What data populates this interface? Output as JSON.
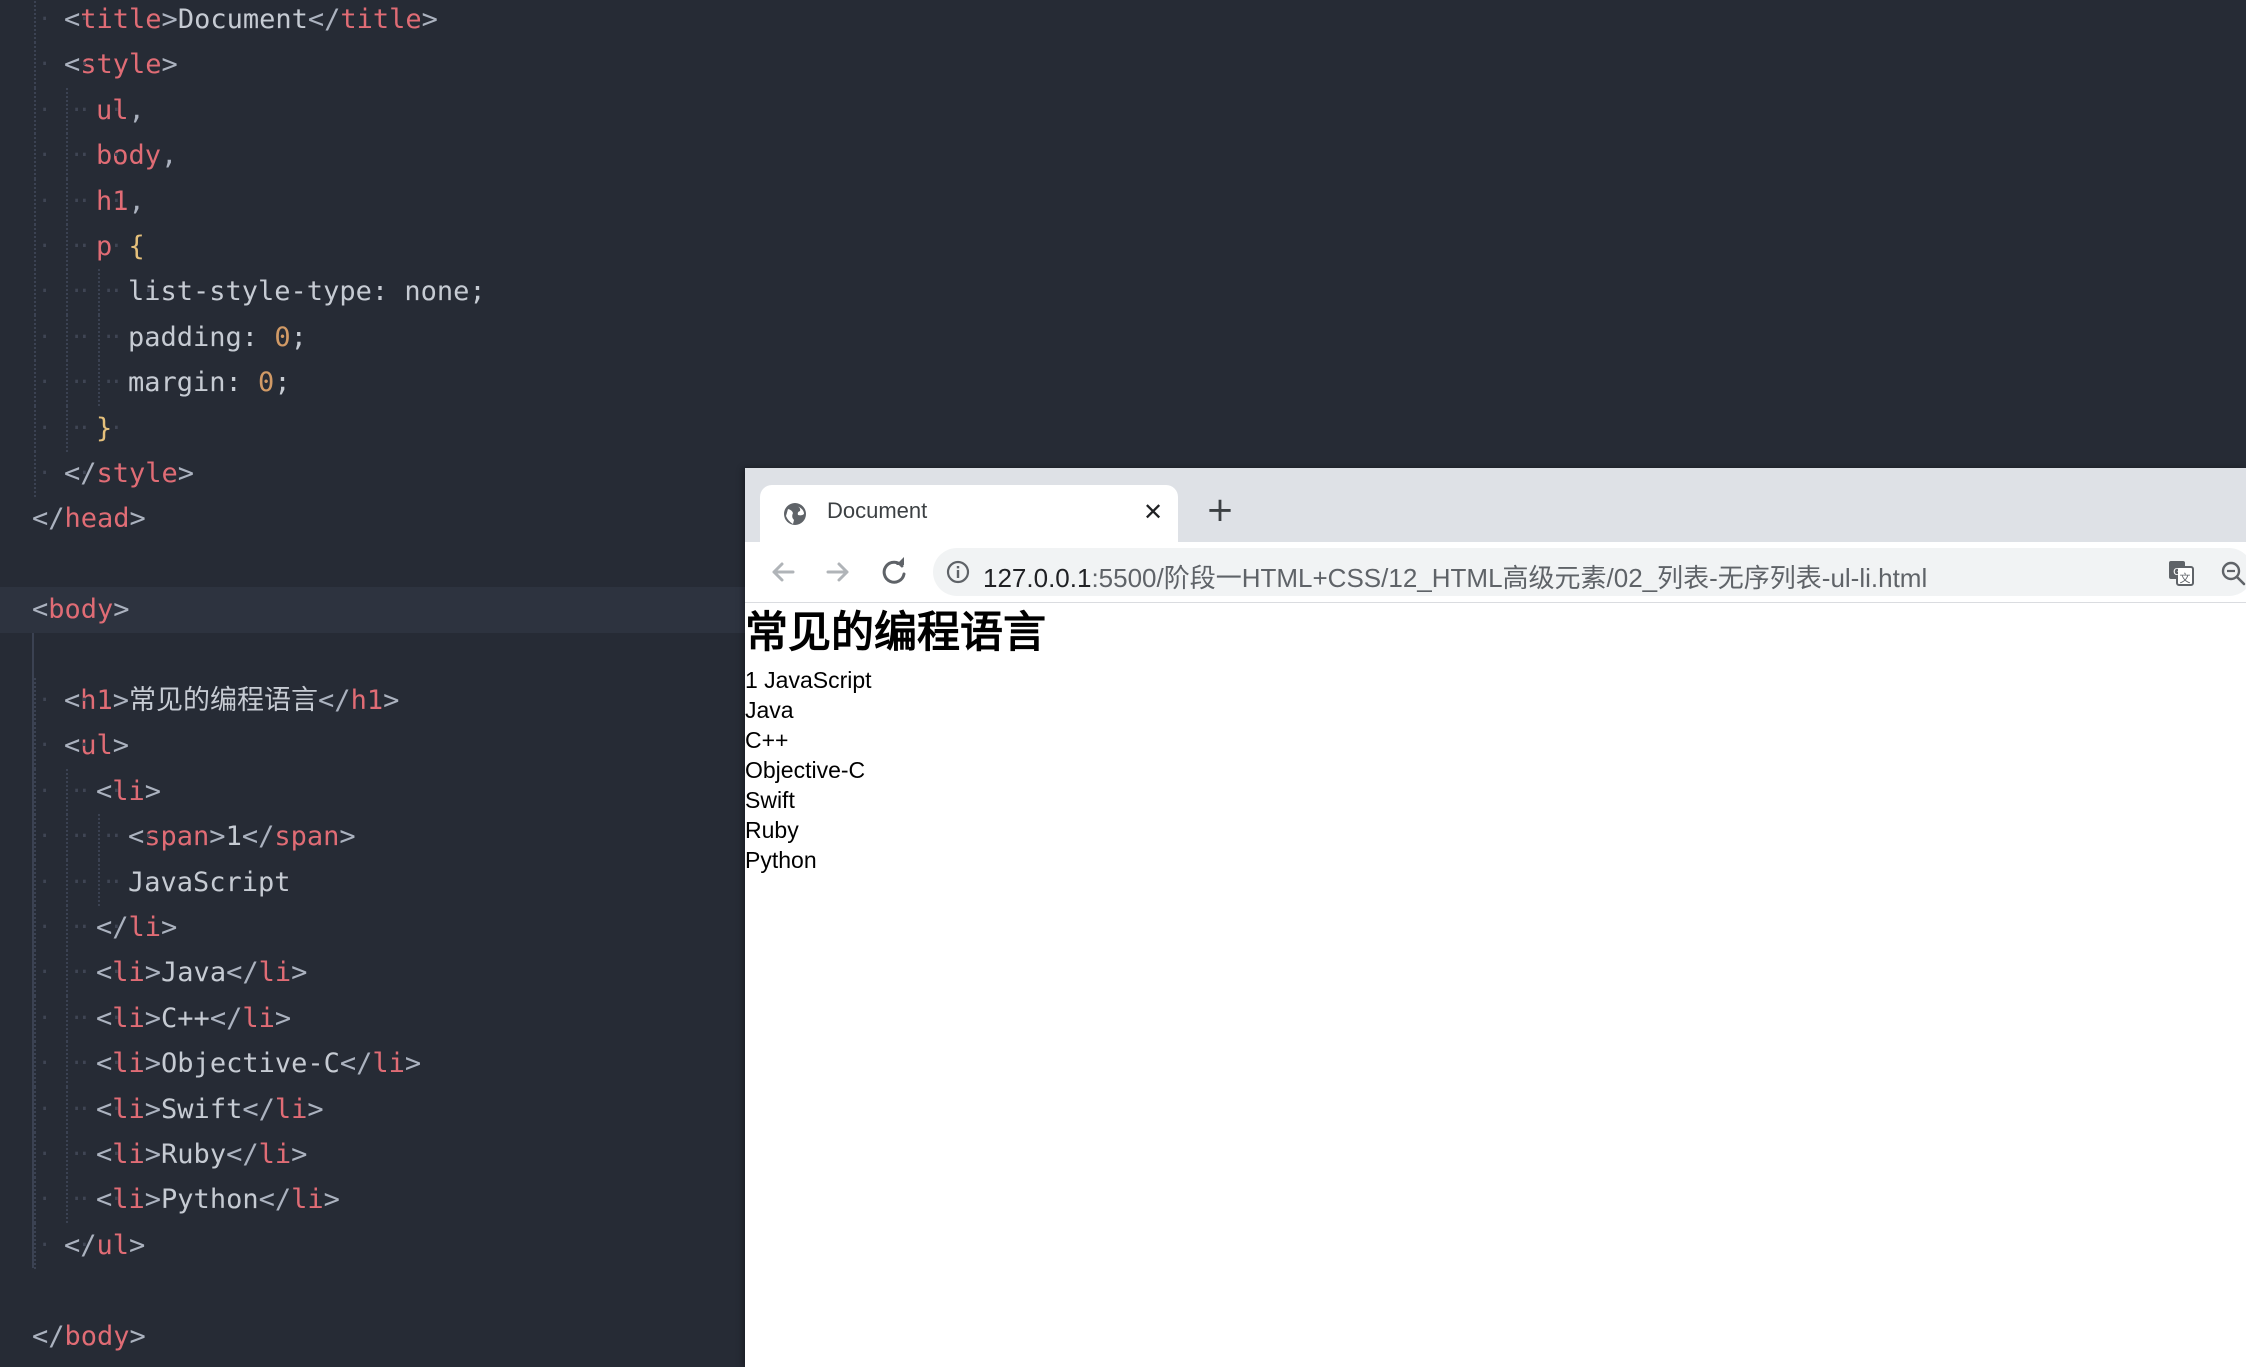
{
  "editor": {
    "lines": [
      [
        [
          "tk-br",
          "<"
        ],
        [
          "tk-tag",
          "title"
        ],
        [
          "tk-br",
          ">"
        ],
        [
          "tk-text",
          "Document"
        ],
        [
          "tk-br",
          "</"
        ],
        [
          "tk-tag",
          "title"
        ],
        [
          "tk-br",
          ">"
        ]
      ],
      [
        [
          "tk-br",
          "<"
        ],
        [
          "tk-tag",
          "style"
        ],
        [
          "tk-br",
          ">"
        ]
      ],
      [
        [
          "tk-sel",
          "ul"
        ],
        [
          "tk-punc",
          ","
        ]
      ],
      [
        [
          "tk-sel",
          "body"
        ],
        [
          "tk-punc",
          ","
        ]
      ],
      [
        [
          "tk-sel",
          "h1"
        ],
        [
          "tk-punc",
          ","
        ]
      ],
      [
        [
          "tk-sel",
          "p "
        ],
        [
          "tk-brace",
          "{"
        ]
      ],
      [
        [
          "tk-prop",
          "list-style-type: none;"
        ]
      ],
      [
        [
          "tk-prop",
          "padding: "
        ],
        [
          "tk-num",
          "0"
        ],
        [
          "tk-prop",
          ";"
        ]
      ],
      [
        [
          "tk-prop",
          "margin: "
        ],
        [
          "tk-num",
          "0"
        ],
        [
          "tk-prop",
          ";"
        ]
      ],
      [
        [
          "tk-brace",
          "}"
        ]
      ],
      [
        [
          "tk-br",
          "</"
        ],
        [
          "tk-tag",
          "style"
        ],
        [
          "tk-br",
          ">"
        ]
      ],
      [
        [
          "tk-br",
          "</"
        ],
        [
          "tk-tag",
          "head"
        ],
        [
          "tk-br",
          ">"
        ]
      ],
      [],
      [
        [
          "tk-br",
          "<"
        ],
        [
          "tk-tag",
          "body"
        ],
        [
          "tk-br",
          ">"
        ]
      ],
      [],
      [
        [
          "tk-br",
          "<"
        ],
        [
          "tk-tag",
          "h1"
        ],
        [
          "tk-br",
          ">"
        ],
        [
          "tk-text",
          "常见的编程语言"
        ],
        [
          "tk-br",
          "</"
        ],
        [
          "tk-tag",
          "h1"
        ],
        [
          "tk-br",
          ">"
        ]
      ],
      [
        [
          "tk-br",
          "<"
        ],
        [
          "tk-tag",
          "ul"
        ],
        [
          "tk-br",
          ">"
        ]
      ],
      [
        [
          "tk-br",
          "<"
        ],
        [
          "tk-tag",
          "li"
        ],
        [
          "tk-br",
          ">"
        ]
      ],
      [
        [
          "tk-br",
          "<"
        ],
        [
          "tk-tag",
          "span"
        ],
        [
          "tk-br",
          ">"
        ],
        [
          "tk-text",
          "1"
        ],
        [
          "tk-br",
          "</"
        ],
        [
          "tk-tag",
          "span"
        ],
        [
          "tk-br",
          ">"
        ]
      ],
      [
        [
          "tk-text",
          "JavaScript"
        ]
      ],
      [
        [
          "tk-br",
          "</"
        ],
        [
          "tk-tag",
          "li"
        ],
        [
          "tk-br",
          ">"
        ]
      ],
      [
        [
          "tk-br",
          "<"
        ],
        [
          "tk-tag",
          "li"
        ],
        [
          "tk-br",
          ">"
        ],
        [
          "tk-text",
          "Java"
        ],
        [
          "tk-br",
          "</"
        ],
        [
          "tk-tag",
          "li"
        ],
        [
          "tk-br",
          ">"
        ]
      ],
      [
        [
          "tk-br",
          "<"
        ],
        [
          "tk-tag",
          "li"
        ],
        [
          "tk-br",
          ">"
        ],
        [
          "tk-text",
          "C++"
        ],
        [
          "tk-br",
          "</"
        ],
        [
          "tk-tag",
          "li"
        ],
        [
          "tk-br",
          ">"
        ]
      ],
      [
        [
          "tk-br",
          "<"
        ],
        [
          "tk-tag",
          "li"
        ],
        [
          "tk-br",
          ">"
        ],
        [
          "tk-text",
          "Objective-C"
        ],
        [
          "tk-br",
          "</"
        ],
        [
          "tk-tag",
          "li"
        ],
        [
          "tk-br",
          ">"
        ]
      ],
      [
        [
          "tk-br",
          "<"
        ],
        [
          "tk-tag",
          "li"
        ],
        [
          "tk-br",
          ">"
        ],
        [
          "tk-text",
          "Swift"
        ],
        [
          "tk-br",
          "</"
        ],
        [
          "tk-tag",
          "li"
        ],
        [
          "tk-br",
          ">"
        ]
      ],
      [
        [
          "tk-br",
          "<"
        ],
        [
          "tk-tag",
          "li"
        ],
        [
          "tk-br",
          ">"
        ],
        [
          "tk-text",
          "Ruby"
        ],
        [
          "tk-br",
          "</"
        ],
        [
          "tk-tag",
          "li"
        ],
        [
          "tk-br",
          ">"
        ]
      ],
      [
        [
          "tk-br",
          "<"
        ],
        [
          "tk-tag",
          "li"
        ],
        [
          "tk-br",
          ">"
        ],
        [
          "tk-text",
          "Python"
        ],
        [
          "tk-br",
          "</"
        ],
        [
          "tk-tag",
          "li"
        ],
        [
          "tk-br",
          ">"
        ]
      ],
      [
        [
          "tk-br",
          "</"
        ],
        [
          "tk-tag",
          "ul"
        ],
        [
          "tk-br",
          ">"
        ]
      ],
      [],
      [
        [
          "tk-br",
          "</"
        ],
        [
          "tk-tag",
          "body"
        ],
        [
          "tk-br",
          ">"
        ]
      ]
    ]
  },
  "browser": {
    "tab_title": "Document",
    "tab_close_glyph": "✕",
    "new_tab_glyph": "+",
    "url_host": "127.0.0.1",
    "url_rest": ":5500/阶段一HTML+CSS/12_HTML高级元素/02_列表-无序列表-ul-li.html",
    "icons": [
      "globe-icon",
      "close-icon",
      "plus-icon",
      "back-arrow-icon",
      "forward-arrow-icon",
      "reload-icon",
      "info-icon",
      "translate-icon",
      "zoom-out-icon"
    ]
  },
  "page": {
    "heading": "常见的编程语言",
    "items": [
      "1 JavaScript",
      "Java",
      "C++",
      "Objective-C",
      "Swift",
      "Ruby",
      "Python"
    ]
  }
}
